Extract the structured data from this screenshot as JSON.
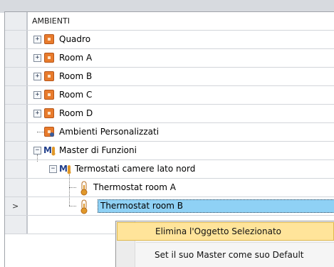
{
  "tree": {
    "header": "AMBIENTI",
    "rows": [
      {
        "label": "Quadro",
        "icon": "room-icon",
        "expander": "+"
      },
      {
        "label": "Room A",
        "icon": "room-icon",
        "expander": "+"
      },
      {
        "label": "Room B",
        "icon": "room-icon",
        "expander": "+"
      },
      {
        "label": "Room C",
        "icon": "room-icon",
        "expander": "+"
      },
      {
        "label": "Room D",
        "icon": "room-icon",
        "expander": "+"
      },
      {
        "label": "Ambienti Personalizzati",
        "icon": "custom-rooms-icon",
        "expander": ""
      },
      {
        "label": "Master di Funzioni",
        "icon": "master-functions-icon",
        "expander": "−"
      },
      {
        "label": "Termostati camere lato nord",
        "icon": "thermostat-group-icon",
        "expander": "−"
      },
      {
        "label": "Thermostat room A",
        "icon": "thermometer-icon",
        "expander": ""
      },
      {
        "label": "Thermostat room B",
        "icon": "thermometer-icon",
        "expander": "",
        "selected": true
      }
    ],
    "current_row_indicator": ">"
  },
  "context_menu": {
    "items": [
      {
        "label": "Elimina l'Oggetto Selezionato",
        "highlighted": true
      },
      {
        "label": "Set il suo Master come suo Default",
        "highlighted": false
      }
    ]
  },
  "colors": {
    "selection": "#8fd1f5",
    "menu_highlight": "#ffe49a",
    "room_icon": "#e87b2c"
  }
}
